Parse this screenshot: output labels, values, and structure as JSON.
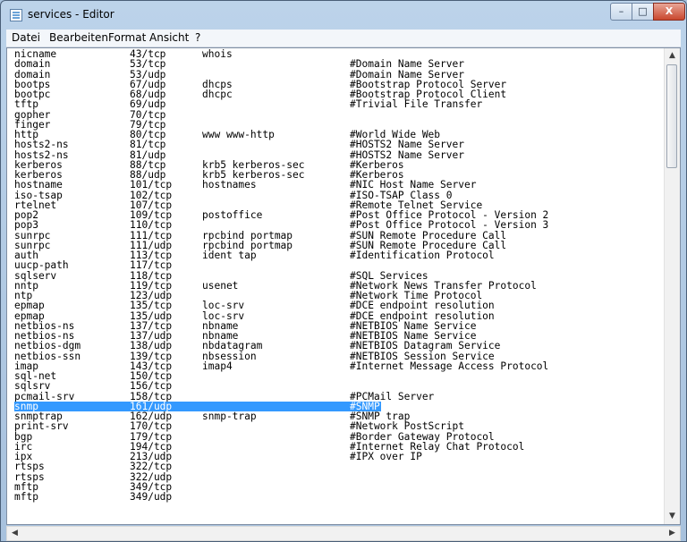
{
  "window": {
    "title": "services - Editor",
    "minimize": "–",
    "maximize": "□",
    "close": "X"
  },
  "menu": [
    "Datei",
    "Bearbeiten",
    "Format",
    "Ansicht",
    "?"
  ],
  "lines": [
    [
      "nicname",
      "43/tcp",
      "whois",
      ""
    ],
    [
      "domain",
      "53/tcp",
      "",
      "#Domain Name Server"
    ],
    [
      "domain",
      "53/udp",
      "",
      "#Domain Name Server"
    ],
    [
      "bootps",
      "67/udp",
      "dhcps",
      "#Bootstrap Protocol Server"
    ],
    [
      "bootpc",
      "68/udp",
      "dhcpc",
      "#Bootstrap Protocol Client"
    ],
    [
      "tftp",
      "69/udp",
      "",
      "#Trivial File Transfer"
    ],
    [
      "gopher",
      "70/tcp",
      "",
      ""
    ],
    [
      "finger",
      "79/tcp",
      "",
      ""
    ],
    [
      "http",
      "80/tcp",
      "www www-http",
      "#World Wide Web"
    ],
    [
      "hosts2-ns",
      "81/tcp",
      "",
      "#HOSTS2 Name Server"
    ],
    [
      "hosts2-ns",
      "81/udp",
      "",
      "#HOSTS2 Name Server"
    ],
    [
      "kerberos",
      "88/tcp",
      "krb5 kerberos-sec",
      "#Kerberos"
    ],
    [
      "kerberos",
      "88/udp",
      "krb5 kerberos-sec",
      "#Kerberos"
    ],
    [
      "hostname",
      "101/tcp",
      "hostnames",
      "#NIC Host Name Server"
    ],
    [
      "iso-tsap",
      "102/tcp",
      "",
      "#ISO-TSAP Class 0"
    ],
    [
      "rtelnet",
      "107/tcp",
      "",
      "#Remote Telnet Service"
    ],
    [
      "pop2",
      "109/tcp",
      "postoffice",
      "#Post Office Protocol - Version 2"
    ],
    [
      "pop3",
      "110/tcp",
      "",
      "#Post Office Protocol - Version 3"
    ],
    [
      "sunrpc",
      "111/tcp",
      "rpcbind portmap",
      "#SUN Remote Procedure Call"
    ],
    [
      "sunrpc",
      "111/udp",
      "rpcbind portmap",
      "#SUN Remote Procedure Call"
    ],
    [
      "auth",
      "113/tcp",
      "ident tap",
      "#Identification Protocol"
    ],
    [
      "uucp-path",
      "117/tcp",
      "",
      ""
    ],
    [
      "sqlserv",
      "118/tcp",
      "",
      "#SQL Services"
    ],
    [
      "nntp",
      "119/tcp",
      "usenet",
      "#Network News Transfer Protocol"
    ],
    [
      "ntp",
      "123/udp",
      "",
      "#Network Time Protocol"
    ],
    [
      "epmap",
      "135/tcp",
      "loc-srv",
      "#DCE endpoint resolution"
    ],
    [
      "epmap",
      "135/udp",
      "loc-srv",
      "#DCE endpoint resolution"
    ],
    [
      "netbios-ns",
      "137/tcp",
      "nbname",
      "#NETBIOS Name Service"
    ],
    [
      "netbios-ns",
      "137/udp",
      "nbname",
      "#NETBIOS Name Service"
    ],
    [
      "netbios-dgm",
      "138/udp",
      "nbdatagram",
      "#NETBIOS Datagram Service"
    ],
    [
      "netbios-ssn",
      "139/tcp",
      "nbsession",
      "#NETBIOS Session Service"
    ],
    [
      "imap",
      "143/tcp",
      "imap4",
      "#Internet Message Access Protocol"
    ],
    [
      "sql-net",
      "150/tcp",
      "",
      ""
    ],
    [
      "sqlsrv",
      "156/tcp",
      "",
      ""
    ],
    [
      "pcmail-srv",
      "158/tcp",
      "",
      "#PCMail Server"
    ],
    [
      "snmp",
      "161/udp",
      "",
      "#SNMP"
    ],
    [
      "snmptrap",
      "162/udp",
      "snmp-trap",
      "#SNMP trap"
    ],
    [
      "print-srv",
      "170/tcp",
      "",
      "#Network PostScript"
    ],
    [
      "bgp",
      "179/tcp",
      "",
      "#Border Gateway Protocol"
    ],
    [
      "irc",
      "194/tcp",
      "",
      "#Internet Relay Chat Protocol"
    ],
    [
      "ipx",
      "213/udp",
      "",
      "#IPX over IP"
    ],
    [
      "rtsps",
      "322/tcp",
      "",
      ""
    ],
    [
      "rtsps",
      "322/udp",
      "",
      ""
    ],
    [
      "mftp",
      "349/tcp",
      "",
      ""
    ],
    [
      "mftp",
      "349/udp",
      "",
      ""
    ]
  ],
  "selected_line": 35,
  "scrollbars": {
    "up": "▲",
    "down": "▼",
    "left": "◀",
    "right": "▶"
  }
}
